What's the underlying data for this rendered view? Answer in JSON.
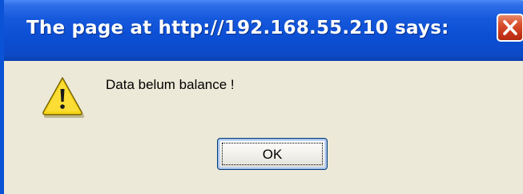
{
  "dialog": {
    "title": "The page at http://192.168.55.210 says:",
    "message": "Data belum balance !",
    "ok_label": "OK",
    "icon": "warning-icon",
    "close_icon": "close-icon"
  },
  "colors": {
    "titlebar": "#0c4ccd",
    "window_bg": "#ece9d8",
    "close_button": "#d9532e",
    "warning_yellow": "#f5d21a"
  }
}
